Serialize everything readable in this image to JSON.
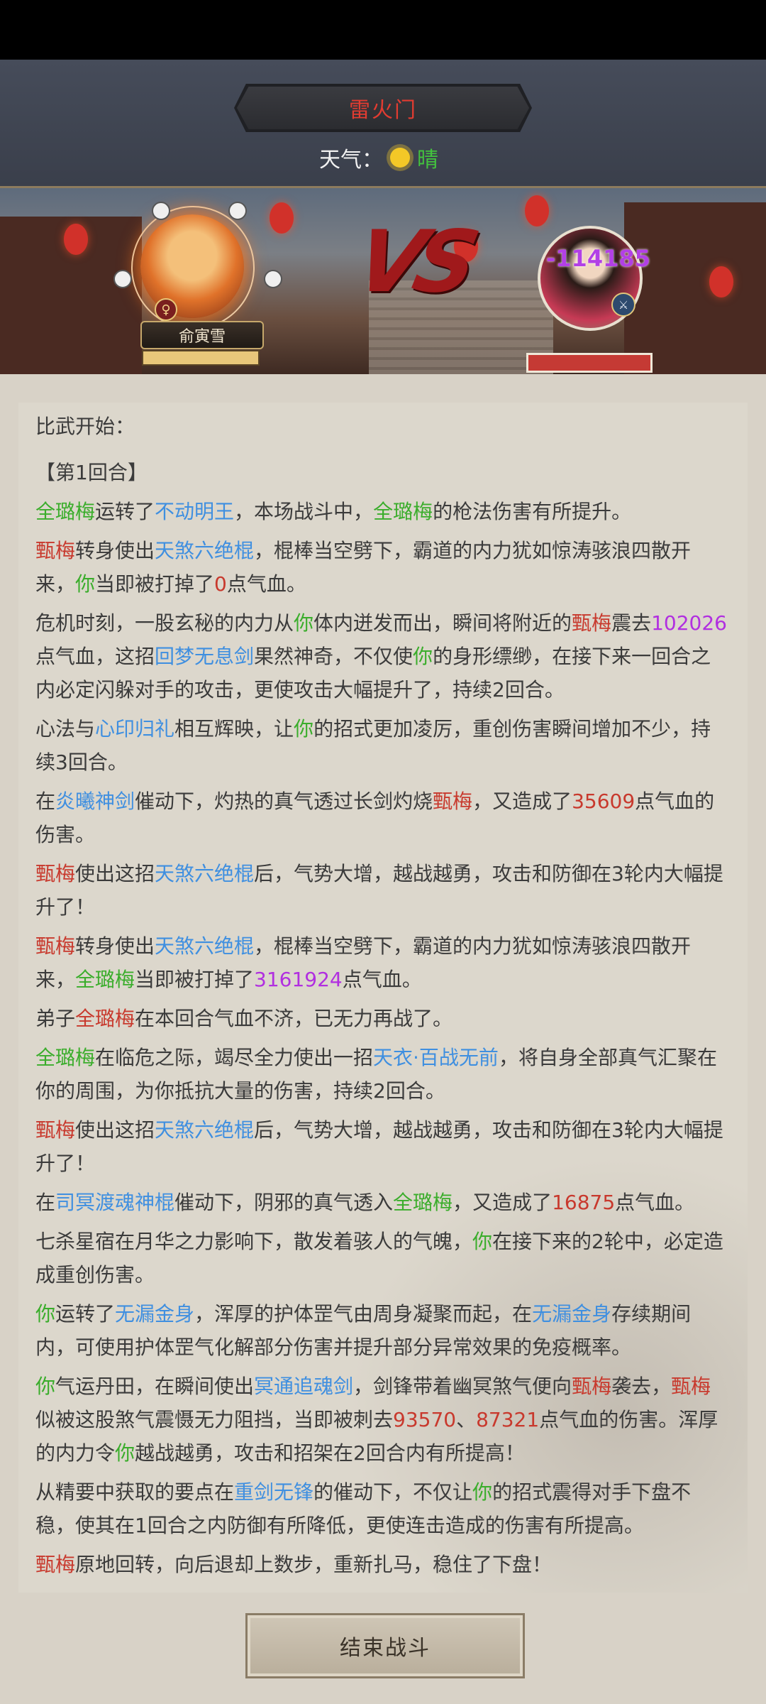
{
  "header": {
    "title": "雷火门",
    "weather_label": "天气：",
    "weather_value": "晴",
    "weather_icon": "sun-icon"
  },
  "arena": {
    "player": {
      "name": "俞寅雪",
      "gender_icon": "♀"
    },
    "vs_text": "VS",
    "enemy": {
      "damage_float": "-114185"
    }
  },
  "log": {
    "intro": "比武开始：",
    "round": "【第1回合】",
    "lines": [
      [
        [
          "g",
          "全璐梅"
        ],
        [
          "t",
          "运转了"
        ],
        [
          "b",
          "不动明王"
        ],
        [
          "t",
          "，本场战斗中，"
        ],
        [
          "g",
          "全璐梅"
        ],
        [
          "t",
          "的枪法伤害有所提升。"
        ]
      ],
      [
        [
          "r",
          "甄梅"
        ],
        [
          "t",
          "转身使出"
        ],
        [
          "b",
          "天煞六绝棍"
        ],
        [
          "t",
          "，棍棒当空劈下，霸道的内力犹如惊涛骇浪四散开来，"
        ],
        [
          "g",
          "你"
        ],
        [
          "t",
          "当即被打掉了"
        ],
        [
          "r",
          "0"
        ],
        [
          "t",
          "点气血。"
        ]
      ],
      [
        [
          "t",
          "危机时刻，一股玄秘的内力从"
        ],
        [
          "g",
          "你"
        ],
        [
          "t",
          "体内迸发而出，瞬间将附近的"
        ],
        [
          "r",
          "甄梅"
        ],
        [
          "t",
          "震去"
        ],
        [
          "p",
          "102026"
        ],
        [
          "t",
          "点气血，这招"
        ],
        [
          "b",
          "回梦无息剑"
        ],
        [
          "t",
          "果然神奇，不仅使"
        ],
        [
          "g",
          "你"
        ],
        [
          "t",
          "的身形缥缈，在接下来一回合之内必定闪躲对手的攻击，更使攻击大幅提升了，持续2回合。"
        ]
      ],
      [
        [
          "t",
          "心法与"
        ],
        [
          "b",
          "心印归礼"
        ],
        [
          "t",
          "相互辉映，让"
        ],
        [
          "g",
          "你"
        ],
        [
          "t",
          "的招式更加凌厉，重创伤害瞬间增加不少，持续3回合。"
        ]
      ],
      [
        [
          "t",
          "在"
        ],
        [
          "b",
          "炎曦神剑"
        ],
        [
          "t",
          "催动下，灼热的真气透过长剑灼烧"
        ],
        [
          "r",
          "甄梅"
        ],
        [
          "t",
          "，又造成了"
        ],
        [
          "r",
          "35609"
        ],
        [
          "t",
          "点气血的伤害。"
        ]
      ],
      [
        [
          "r",
          "甄梅"
        ],
        [
          "t",
          "使出这招"
        ],
        [
          "b",
          "天煞六绝棍"
        ],
        [
          "t",
          "后，气势大增，越战越勇，攻击和防御在3轮内大幅提升了！"
        ]
      ],
      [
        [
          "r",
          "甄梅"
        ],
        [
          "t",
          "转身使出"
        ],
        [
          "b",
          "天煞六绝棍"
        ],
        [
          "t",
          "，棍棒当空劈下，霸道的内力犹如惊涛骇浪四散开来，"
        ],
        [
          "g",
          "全璐梅"
        ],
        [
          "t",
          "当即被打掉了"
        ],
        [
          "p",
          "3161924"
        ],
        [
          "t",
          "点气血。"
        ]
      ],
      [
        [
          "t",
          "弟子"
        ],
        [
          "r",
          "全璐梅"
        ],
        [
          "t",
          "在本回合气血不济，已无力再战了。"
        ]
      ],
      [
        [
          "g",
          "全璐梅"
        ],
        [
          "t",
          "在临危之际，竭尽全力使出一招"
        ],
        [
          "b",
          "天衣·百战无前"
        ],
        [
          "t",
          "，将自身全部真气汇聚在你的周围，为你抵抗大量的伤害，持续2回合。"
        ]
      ],
      [
        [
          "r",
          "甄梅"
        ],
        [
          "t",
          "使出这招"
        ],
        [
          "b",
          "天煞六绝棍"
        ],
        [
          "t",
          "后，气势大增，越战越勇，攻击和防御在3轮内大幅提升了！"
        ]
      ],
      [
        [
          "t",
          "在"
        ],
        [
          "b",
          "司冥渡魂神棍"
        ],
        [
          "t",
          "催动下，阴邪的真气透入"
        ],
        [
          "g",
          "全璐梅"
        ],
        [
          "t",
          "，又造成了"
        ],
        [
          "r",
          "16875"
        ],
        [
          "t",
          "点气血。"
        ]
      ],
      [
        [
          "t",
          "七杀星宿在月华之力影响下，散发着骇人的气魄，"
        ],
        [
          "g",
          "你"
        ],
        [
          "t",
          "在接下来的2轮中，必定造成重创伤害。"
        ]
      ],
      [
        [
          "g",
          "你"
        ],
        [
          "t",
          "运转了"
        ],
        [
          "b",
          "无漏金身"
        ],
        [
          "t",
          "，浑厚的护体罡气由周身凝聚而起，在"
        ],
        [
          "b",
          "无漏金身"
        ],
        [
          "t",
          "存续期间内，可使用护体罡气化解部分伤害并提升部分异常效果的免疫概率。"
        ]
      ],
      [
        [
          "g",
          "你"
        ],
        [
          "t",
          "气运丹田，在瞬间使出"
        ],
        [
          "b",
          "冥通追魂剑"
        ],
        [
          "t",
          "，剑锋带着幽冥煞气便向"
        ],
        [
          "r",
          "甄梅"
        ],
        [
          "t",
          "袭去，"
        ],
        [
          "r",
          "甄梅"
        ],
        [
          "t",
          "似被这股煞气震慑无力阻挡，当即被刺去"
        ],
        [
          "r",
          "93570"
        ],
        [
          "t",
          "、"
        ],
        [
          "r",
          "87321"
        ],
        [
          "t",
          "点气血的伤害。浑厚的内力令"
        ],
        [
          "g",
          "你"
        ],
        [
          "t",
          "越战越勇，攻击和招架在2回合内有所提高！"
        ]
      ],
      [
        [
          "t",
          "从精要中获取的要点在"
        ],
        [
          "b",
          "重剑无锋"
        ],
        [
          "t",
          "的催动下，不仅让"
        ],
        [
          "g",
          "你"
        ],
        [
          "t",
          "的招式震得对手下盘不稳，使其在1回合之内防御有所降低，更使连击造成的伤害有所提高。"
        ]
      ],
      [
        [
          "r",
          "甄梅"
        ],
        [
          "t",
          "原地回转，向后退却上数步，重新扎马，稳住了下盘！"
        ]
      ]
    ]
  },
  "footer": {
    "end_button": "结束战斗"
  }
}
